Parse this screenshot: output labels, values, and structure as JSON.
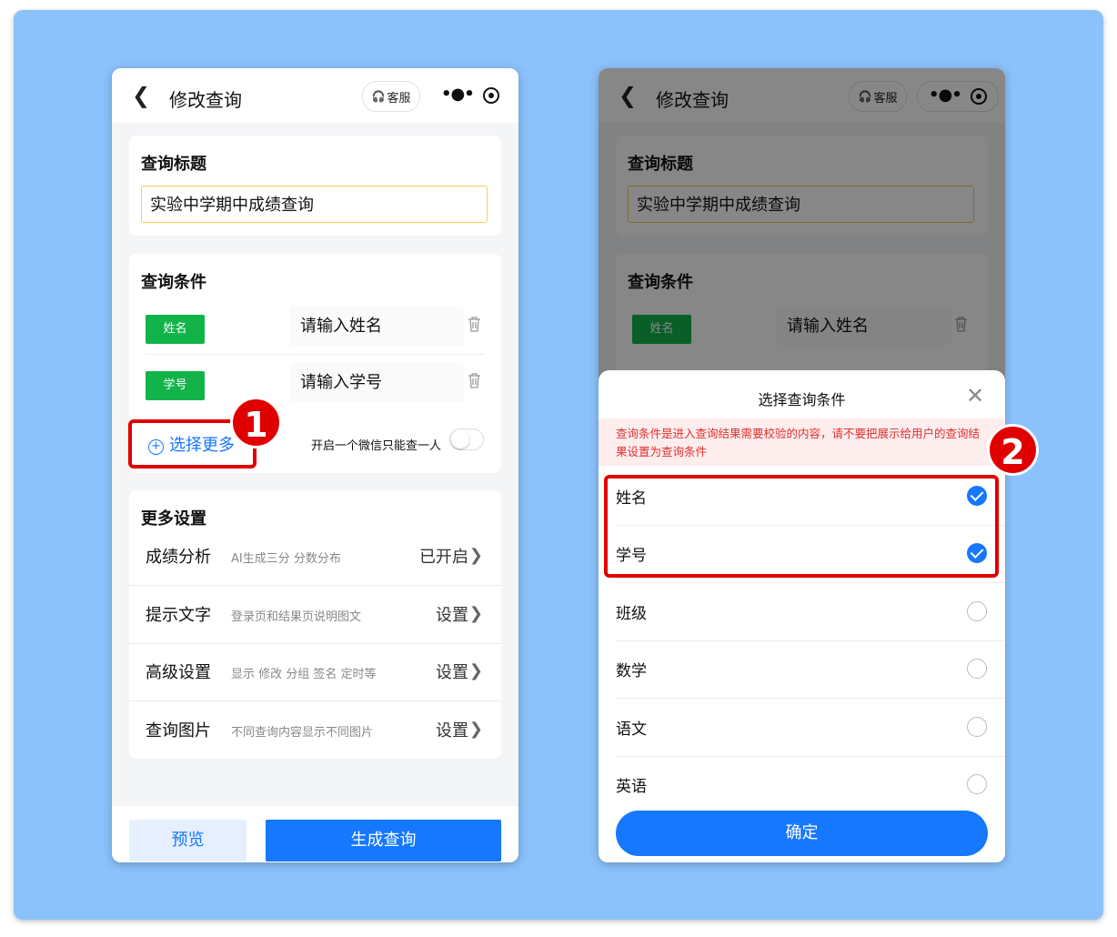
{
  "left_screen": {
    "nav": {
      "back_icon": "chevron-left-icon",
      "title": "修改查询",
      "service_label": "客服",
      "service_icon": "headphones-icon",
      "more_icon": "more-dots-icon",
      "close_icon": "target-circle-icon"
    },
    "title_section": {
      "heading": "查询标题",
      "value": "实验中学期中成绩查询"
    },
    "conditions_section": {
      "heading": "查询条件",
      "rows": [
        {
          "tag": "姓名",
          "placeholder": "请输入姓名"
        },
        {
          "tag": "学号",
          "placeholder": "请输入学号"
        }
      ],
      "select_more": "选择更多",
      "toggle_label": "开启一个微信只能查一人",
      "toggle_on": false
    },
    "more_settings": {
      "heading": "更多设置",
      "items": [
        {
          "name": "成绩分析",
          "desc": "AI生成三分 分数分布",
          "value": "已开启"
        },
        {
          "name": "提示文字",
          "desc": "登录页和结果页说明图文",
          "value": "设置"
        },
        {
          "name": "高级设置",
          "desc": "显示 修改 分组 签名 定时等",
          "value": "设置"
        },
        {
          "name": "查询图片",
          "desc": "不同查询内容显示不同图片",
          "value": "设置"
        }
      ]
    },
    "footer": {
      "preview": "预览",
      "generate": "生成查询"
    }
  },
  "right_screen": {
    "sheet": {
      "title": "选择查询条件",
      "warning": "查询条件是进入查询结果需要校验的内容，请不要把展示给用户的查询结果设置为查询条件",
      "options": [
        {
          "label": "姓名",
          "checked": true
        },
        {
          "label": "学号",
          "checked": true
        },
        {
          "label": "班级",
          "checked": false
        },
        {
          "label": "数学",
          "checked": false
        },
        {
          "label": "语文",
          "checked": false
        },
        {
          "label": "英语",
          "checked": false
        }
      ],
      "confirm": "确定"
    }
  },
  "annotations": {
    "badge1": "1",
    "badge2": "2",
    "highlight_color": "#e00000"
  },
  "colors": {
    "background": "#8bc2fb",
    "primary": "#1677ff",
    "tag_green": "#12b44a",
    "warning_red": "#e0302f"
  }
}
